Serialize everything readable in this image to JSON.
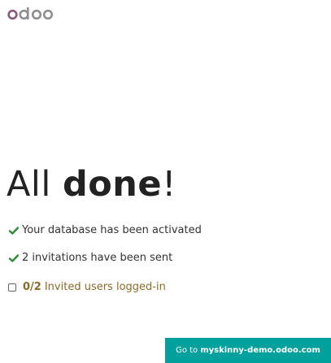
{
  "logo": {
    "text": "odoo"
  },
  "heading": {
    "light": "All ",
    "bold": "done",
    "suffix": "!"
  },
  "status": {
    "activated": "Your database has been activated",
    "invitations": "2 invitations have been sent",
    "invited_count": "0/2",
    "invited_label": "Invited users logged-in"
  },
  "go_button": {
    "prefix": "Go to",
    "domain": "myskinny-demo.odoo.com"
  },
  "colors": {
    "accent": "#00a09d",
    "check": "#2e8b3a",
    "progress": "#8a6a2a"
  }
}
